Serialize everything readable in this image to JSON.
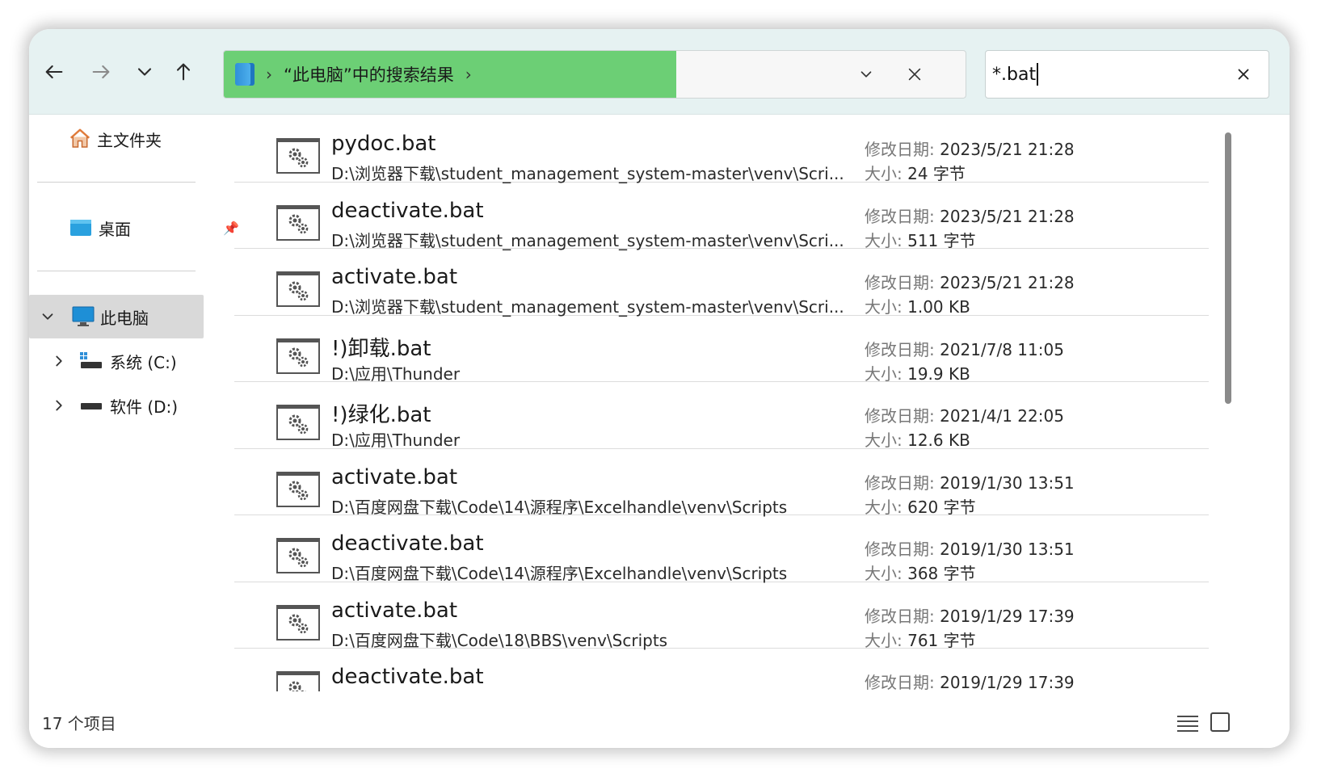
{
  "nav": {
    "back_icon": "arrow-left-icon",
    "forward_icon": "arrow-right-icon",
    "recent_icon": "chevron-down-icon",
    "up_icon": "arrow-up-icon"
  },
  "address": {
    "breadcrumb": "“此电脑”中的搜索结果",
    "progress_percent": 61
  },
  "search": {
    "value": "*.bat"
  },
  "sidebar": {
    "home": "主文件夹",
    "desktop": "桌面",
    "this_pc": "此电脑",
    "drive_c": "系统 (C:)",
    "drive_d": "软件 (D:)"
  },
  "labels": {
    "date": "修改日期: ",
    "size": "大小: "
  },
  "files": [
    {
      "name": "pydoc.bat",
      "path": "D:\\浏览器下载\\student_management_system-master\\venv\\Scri...",
      "date": "2023/5/21 21:28",
      "size": "24 字节"
    },
    {
      "name": "deactivate.bat",
      "path": "D:\\浏览器下载\\student_management_system-master\\venv\\Scri...",
      "date": "2023/5/21 21:28",
      "size": "511 字节"
    },
    {
      "name": "activate.bat",
      "path": "D:\\浏览器下载\\student_management_system-master\\venv\\Scri...",
      "date": "2023/5/21 21:28",
      "size": "1.00 KB"
    },
    {
      "name": "!)卸载.bat",
      "path": "D:\\应用\\Thunder",
      "date": "2021/7/8 11:05",
      "size": "19.9 KB"
    },
    {
      "name": "!)绿化.bat",
      "path": "D:\\应用\\Thunder",
      "date": "2021/4/1 22:05",
      "size": "12.6 KB"
    },
    {
      "name": "activate.bat",
      "path": "D:\\百度网盘下载\\Code\\14\\源程序\\Excelhandle\\venv\\Scripts",
      "date": "2019/1/30 13:51",
      "size": "620 字节"
    },
    {
      "name": "deactivate.bat",
      "path": "D:\\百度网盘下载\\Code\\14\\源程序\\Excelhandle\\venv\\Scripts",
      "date": "2019/1/30 13:51",
      "size": "368 字节"
    },
    {
      "name": "activate.bat",
      "path": "D:\\百度网盘下载\\Code\\18\\BBS\\venv\\Scripts",
      "date": "2019/1/29 17:39",
      "size": "761 字节"
    },
    {
      "name": "deactivate.bat",
      "path": "",
      "date": "2019/1/29 17:39",
      "size": ""
    }
  ],
  "status": {
    "item_count": "17 个项目"
  },
  "colors": {
    "toolbar_bg": "#e6f2f2",
    "progress_green": "#6ccf75"
  }
}
